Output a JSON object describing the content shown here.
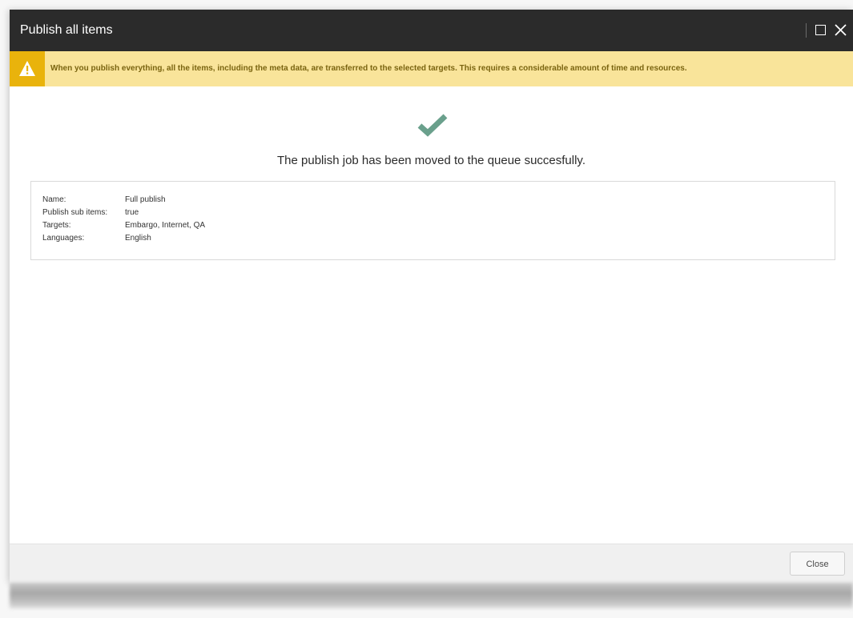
{
  "dialog": {
    "title": "Publish all items"
  },
  "warning": {
    "text": "When you publish everything, all the items, including the meta data, are transferred to the selected targets. This requires a considerable amount of time and resources."
  },
  "result": {
    "message": "The publish job has been moved to the queue succesfully."
  },
  "details": [
    {
      "label": "Name:",
      "value": "Full publish"
    },
    {
      "label": "Publish sub items:",
      "value": "true"
    },
    {
      "label": "Targets:",
      "value": "Embargo, Internet, QA"
    },
    {
      "label": "Languages:",
      "value": "English"
    }
  ],
  "footer": {
    "close_label": "Close"
  },
  "colors": {
    "titlebar": "#2b2b2b",
    "warning_bg": "#f9e49a",
    "warning_icon_bg": "#e9b30c",
    "check": "#6aa08c"
  },
  "icons": {
    "maximize": "maximize-icon",
    "close": "close-icon",
    "warning": "warning-icon",
    "success": "checkmark-icon"
  }
}
